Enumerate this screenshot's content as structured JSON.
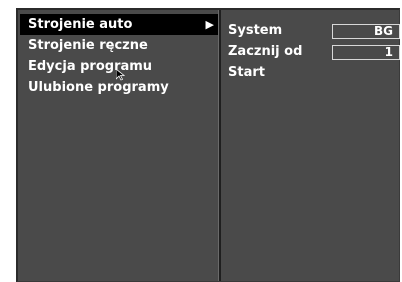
{
  "left_menu": {
    "items": [
      {
        "label": "Strojenie auto",
        "selected": true,
        "has_submenu": true
      },
      {
        "label": "Strojenie ręczne",
        "selected": false
      },
      {
        "label": "Edycja programu",
        "selected": false
      },
      {
        "label": "Ulubione programy",
        "selected": false
      }
    ],
    "arrow_glyph": "▶"
  },
  "right_panel": {
    "rows": [
      {
        "label": "System",
        "value": "BG"
      },
      {
        "label": "Zacznij  od",
        "value": "1"
      },
      {
        "label": "Start",
        "value": ""
      }
    ]
  },
  "colors": {
    "panel_background": "#4a4a4a",
    "selection_background": "#000000",
    "text": "#ffffff",
    "value_border": "#d8d8d8"
  }
}
